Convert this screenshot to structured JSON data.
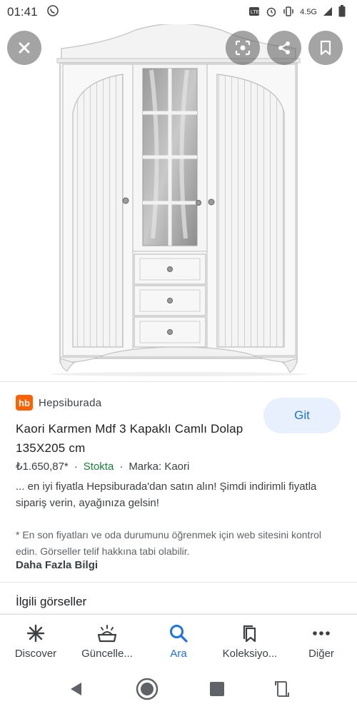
{
  "status_bar": {
    "time": "01:41",
    "network": "4.5G",
    "icons": [
      "whatsapp-icon",
      "volte-icon",
      "alarm-icon",
      "vibrate-icon",
      "signal-icon",
      "battery-icon"
    ]
  },
  "image": {
    "description_icon": "wardrobe-image",
    "buttons": [
      "close-icon",
      "lens-icon",
      "share-icon",
      "bookmark-icon"
    ]
  },
  "result": {
    "source_logo": "hb",
    "source_name": "Hepsiburada",
    "visit_label": "Git",
    "title": "Kaori Karmen Mdf 3 Kapaklı Camlı Dolap 135X205 cm",
    "price": "₺1.650,87*",
    "sep1": "·",
    "stock": "Stokta",
    "sep2": "·",
    "brand": "Marka: Kaori",
    "description": "... en iyi fiyatla Hepsiburada'dan satın alın! Şimdi indirimli fiyatla sipariş verin, ayağınıza gelsin!",
    "disclaimer": "* En son fiyatları ve oda durumunu öğrenmek için web sitesini kontrol edin. Görseller telif hakkına tabi olabilir.",
    "more_info": "Daha Fazla Bilgi",
    "related_heading": "İlgili görseller"
  },
  "bottom_nav": {
    "items": [
      {
        "label": "Discover",
        "icon": "asterisk-icon"
      },
      {
        "label": "Güncelle...",
        "icon": "updates-icon"
      },
      {
        "label": "Ara",
        "icon": "search-icon"
      },
      {
        "label": "Koleksiyo...",
        "icon": "collections-icon"
      },
      {
        "label": "Diğer",
        "icon": "more-icon"
      }
    ],
    "active_index": 2
  },
  "colors": {
    "accent": "#1a73e8",
    "brand": "#ff6000",
    "stock": "#188038"
  }
}
